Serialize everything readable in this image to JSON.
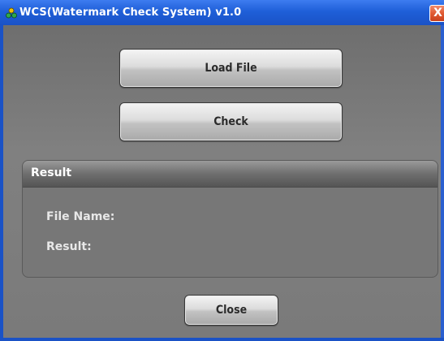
{
  "window": {
    "title": "WCS(Watermark Check System) v1.0",
    "icon": "cluster-app-icon",
    "close_glyph": "X"
  },
  "buttons": {
    "load_file": "Load File",
    "check": "Check",
    "close": "Close"
  },
  "result_panel": {
    "title": "Result",
    "file_name_label": "File Name:",
    "result_label": "Result:"
  },
  "colors": {
    "titlebar": "#1f5fd8",
    "client_bg": "#7a7a7a",
    "button_face": "#c8c8c8",
    "close_button": "#e05a32"
  }
}
